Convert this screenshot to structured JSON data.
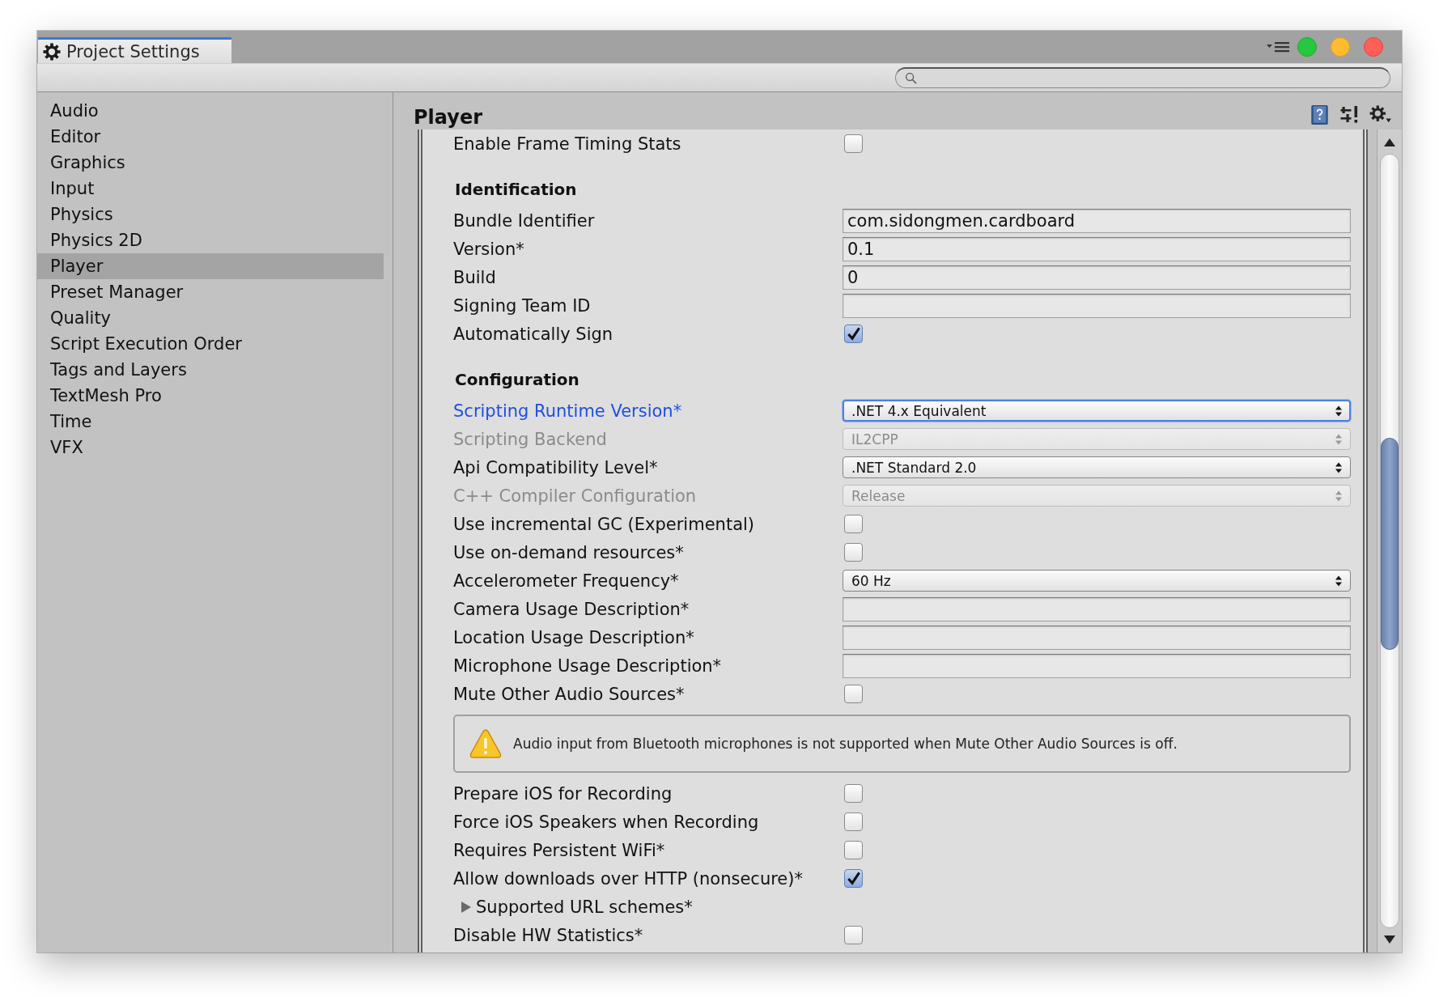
{
  "window": {
    "tab_title": "Project Settings"
  },
  "sidebar": {
    "items": [
      {
        "label": "Audio",
        "selected": false
      },
      {
        "label": "Editor",
        "selected": false
      },
      {
        "label": "Graphics",
        "selected": false
      },
      {
        "label": "Input",
        "selected": false
      },
      {
        "label": "Physics",
        "selected": false
      },
      {
        "label": "Physics 2D",
        "selected": false
      },
      {
        "label": "Player",
        "selected": true
      },
      {
        "label": "Preset Manager",
        "selected": false
      },
      {
        "label": "Quality",
        "selected": false
      },
      {
        "label": "Script Execution Order",
        "selected": false
      },
      {
        "label": "Tags and Layers",
        "selected": false
      },
      {
        "label": "TextMesh Pro",
        "selected": false
      },
      {
        "label": "Time",
        "selected": false
      },
      {
        "label": "VFX",
        "selected": false
      }
    ]
  },
  "panel": {
    "title": "Player",
    "rows": [
      {
        "kind": "checkbox",
        "label": "Enable Frame Timing Stats",
        "checked": false
      },
      {
        "kind": "header",
        "label": "Identification"
      },
      {
        "kind": "text",
        "label": "Bundle Identifier",
        "value": "com.sidongmen.cardboard"
      },
      {
        "kind": "text",
        "label": "Version*",
        "value": "0.1"
      },
      {
        "kind": "text",
        "label": "Build",
        "value": "0"
      },
      {
        "kind": "text",
        "label": "Signing Team ID"
      },
      {
        "kind": "checkbox",
        "label": "Automatically Sign",
        "checked": true
      },
      {
        "kind": "header",
        "label": "Configuration"
      },
      {
        "kind": "dropdown",
        "label": "Scripting Runtime Version*",
        "value": ".NET 4.x Equivalent",
        "disabled": false,
        "focused": true
      },
      {
        "kind": "dropdown",
        "label": "Scripting Backend",
        "value": "IL2CPP",
        "disabled": true,
        "focused": false
      },
      {
        "kind": "dropdown",
        "label": "Api Compatibility Level*",
        "value": ".NET Standard 2.0",
        "disabled": false,
        "focused": false
      },
      {
        "kind": "dropdown",
        "label": "C++ Compiler Configuration",
        "value": "Release",
        "disabled": true,
        "focused": false
      },
      {
        "kind": "checkbox",
        "label": "Use incremental GC (Experimental)",
        "checked": false
      },
      {
        "kind": "checkbox",
        "label": "Use on-demand resources*",
        "checked": false
      },
      {
        "kind": "dropdown",
        "label": "Accelerometer Frequency*",
        "value": "60 Hz",
        "disabled": false,
        "focused": false
      },
      {
        "kind": "text",
        "label": "Camera Usage Description*"
      },
      {
        "kind": "text",
        "label": "Location Usage Description*"
      },
      {
        "kind": "text",
        "label": "Microphone Usage Description*"
      },
      {
        "kind": "checkbox",
        "label": "Mute Other Audio Sources*",
        "checked": false
      },
      {
        "kind": "warning",
        "text": "Audio input from Bluetooth microphones is not supported when Mute Other Audio Sources is off."
      },
      {
        "kind": "checkbox",
        "label": "Prepare iOS for Recording",
        "checked": false
      },
      {
        "kind": "checkbox",
        "label": "Force iOS Speakers when Recording",
        "checked": false
      },
      {
        "kind": "checkbox",
        "label": "Requires Persistent WiFi*",
        "checked": false
      },
      {
        "kind": "checkbox",
        "label": "Allow downloads over HTTP (nonsecure)*",
        "checked": true
      },
      {
        "kind": "foldout",
        "label": "Supported URL schemes*",
        "expanded": false
      },
      {
        "kind": "checkbox",
        "label": "Disable HW Statistics*",
        "checked": false
      }
    ]
  }
}
